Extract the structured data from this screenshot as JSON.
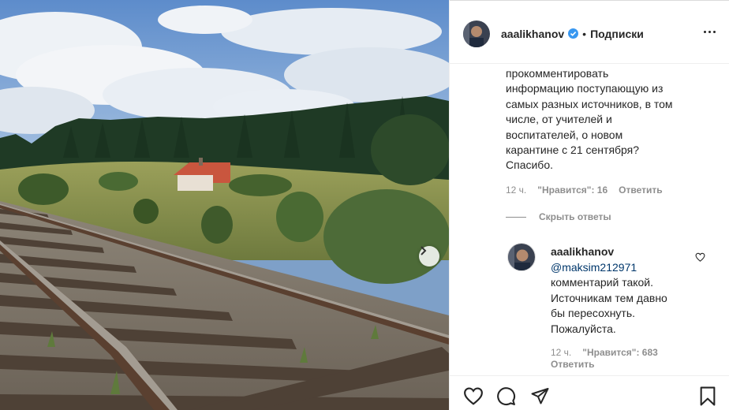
{
  "post": {
    "author": "aaalikhanov",
    "follow_label": "Подписки",
    "separator": "•"
  },
  "comment": {
    "text_lines": [
      "прокомментировать",
      "информацию поступающую из",
      "самых разных источников, в том",
      "числе, от учителей и",
      "воспитателей, о новом",
      "карантине с 21 сентября?",
      "Спасибо."
    ],
    "time": "12 ч.",
    "likes": "\"Нравится\": 16",
    "reply_label": "Ответить",
    "hide_replies_label": "Скрыть ответы"
  },
  "reply": {
    "author": "aaalikhanov",
    "mention": "@maksim212971",
    "text_lines": [
      "комментарий такой.",
      "Источникам тем давно",
      "бы пересохнуть.",
      "Пожалуйста."
    ],
    "time": "12 ч.",
    "likes": "\"Нравится\": 683",
    "reply_label": "Ответить"
  },
  "icons": {
    "more": "more-options-icon",
    "verified": "verified-badge-icon",
    "like": "heart-icon",
    "comment": "comment-icon",
    "share": "share-icon",
    "save": "bookmark-icon",
    "next": "chevron-right-icon"
  },
  "colors": {
    "verified": "#3897f0",
    "text": "#262626",
    "secondary": "#8e8e8e",
    "mention": "#00376b"
  }
}
